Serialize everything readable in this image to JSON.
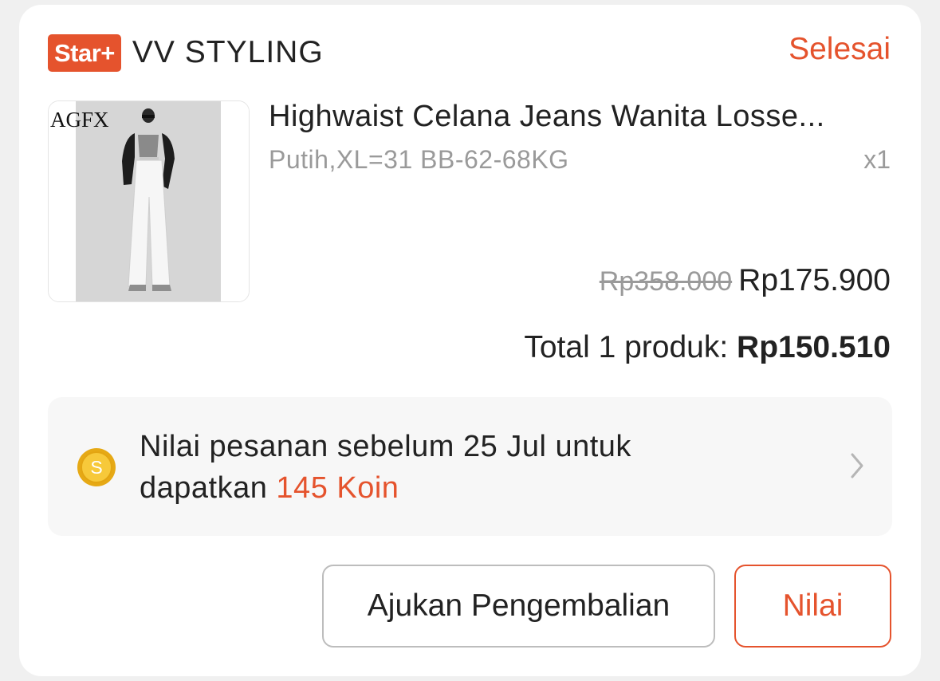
{
  "shop": {
    "badge": "Star+",
    "name": "VV STYLING",
    "status": "Selesai"
  },
  "product": {
    "image_logo": "AGFX",
    "title": "Highwaist Celana Jeans Wanita Losse...",
    "variant": "Putih,XL=31 BB-62-68KG",
    "quantity": "x1",
    "original_price": "Rp358.000",
    "price": "Rp175.900"
  },
  "total": {
    "label": "Total 1 produk: ",
    "value": "Rp150.510"
  },
  "coins": {
    "icon": "coin-icon",
    "text_line1": "Nilai pesanan sebelum 25 Jul untuk",
    "text_line2_prefix": "dapatkan ",
    "highlight": "145 Koin"
  },
  "actions": {
    "return_label": "Ajukan Pengembalian",
    "rate_label": "Nilai"
  },
  "colors": {
    "accent": "#e5532d",
    "text": "#222222",
    "muted": "#9a9a9a",
    "panel": "#f7f7f7"
  }
}
